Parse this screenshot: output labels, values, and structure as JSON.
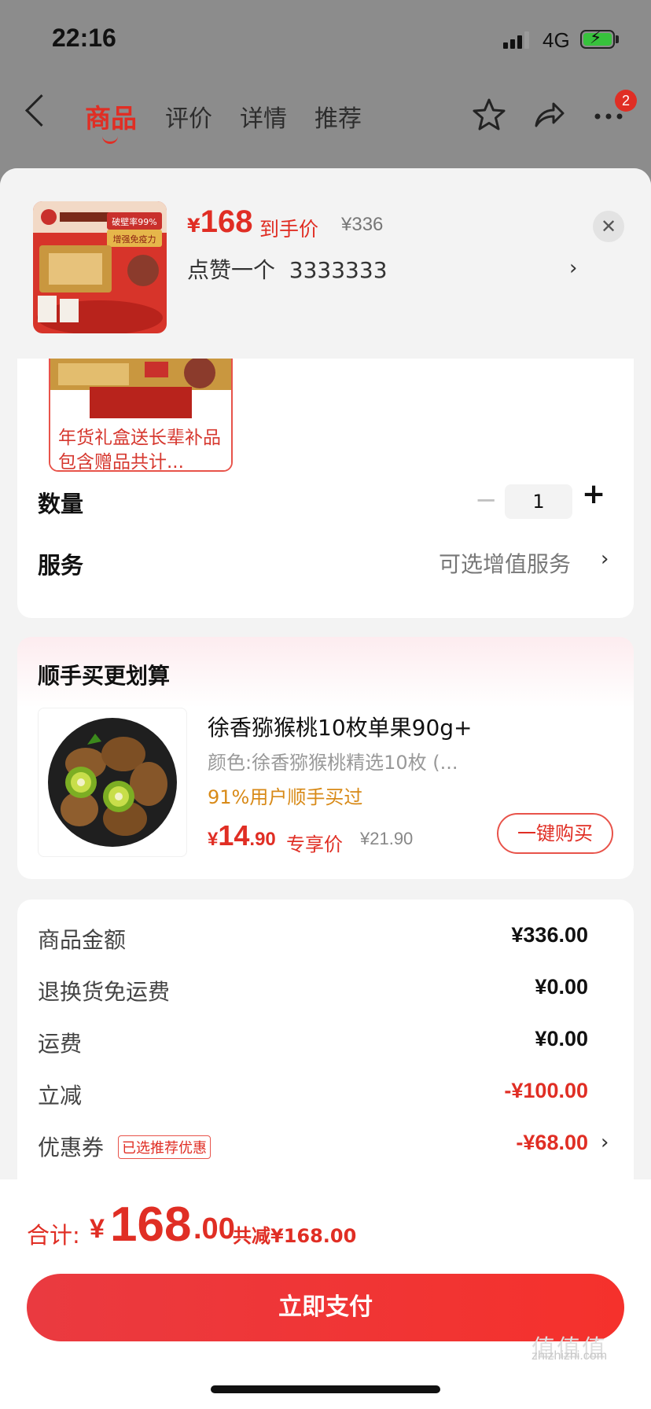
{
  "status_bar": {
    "time": "22:16",
    "network": "4G"
  },
  "nav": {
    "tabs": [
      {
        "label": "商品",
        "active": true
      },
      {
        "label": "评价",
        "active": false
      },
      {
        "label": "详情",
        "active": false
      },
      {
        "label": "推荐",
        "active": false
      }
    ],
    "icons": [
      "back-icon",
      "star-icon",
      "share-icon",
      "more-icon"
    ],
    "badge_count": "2"
  },
  "summary": {
    "price_symbol": "¥",
    "price": "168",
    "price_tag": "到手价",
    "original_price": "¥336",
    "variant": "点赞一个  3333333",
    "product_image_text": [
      "破壁率99%",
      "增强免疫力"
    ]
  },
  "spec": {
    "image_caption": "年货礼盒送长辈补品 包含赠品共计...",
    "quantity_label": "数量",
    "quantity_value": "1",
    "service_label": "服务",
    "service_value": "可选增值服务"
  },
  "upsell": {
    "title": "顺手买更划算",
    "product_name": "徐香猕猴桃10枚单果90g+",
    "spec": "颜色:徐香猕猴桃精选10枚 (...",
    "stat": "91%用户顺手买过",
    "price_symbol": "¥",
    "price_int": "14",
    "price_dec": ".90",
    "price_tag": "专享价",
    "original_price": "¥21.90",
    "buy_button": "一键购买"
  },
  "costs": {
    "rows": [
      {
        "label": "商品金额",
        "value": "¥336.00"
      },
      {
        "label": "退换货免运费",
        "value": "¥0.00"
      },
      {
        "label": "运费",
        "value": "¥0.00"
      },
      {
        "label": "立减",
        "value": "-¥100.00"
      },
      {
        "label": "优惠券",
        "value": "-¥68.00",
        "tag": "已选推荐优惠"
      }
    ]
  },
  "footer": {
    "total_label": "合计:",
    "total_symbol": "¥",
    "total_int": "168",
    "total_dec": ".00",
    "total_saved": "共减¥168.00",
    "pay_button": "立即支付",
    "watermark": "zhizhizhi.com"
  },
  "colors": {
    "accent": "#e02e24",
    "coupon_orange": "#d88a18"
  }
}
